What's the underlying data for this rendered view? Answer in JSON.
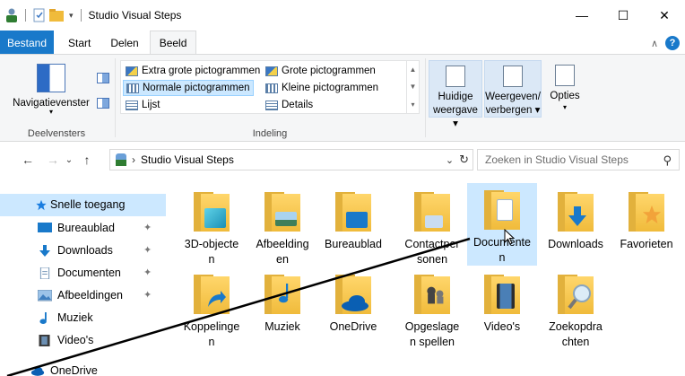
{
  "window": {
    "title": "Studio Visual Steps",
    "controls": {
      "minimize": "—",
      "maximize": "☐",
      "close": "✕"
    }
  },
  "ribbon": {
    "tabs": [
      {
        "label": "Bestand"
      },
      {
        "label": "Start"
      },
      {
        "label": "Delen"
      },
      {
        "label": "Beeld"
      }
    ],
    "panes_group": {
      "label": "Deelvensters",
      "nav_pane_label": "Navigatievenster"
    },
    "layout_group": {
      "label": "Indeling",
      "items": [
        {
          "label": "Extra grote pictogrammen",
          "selected": false
        },
        {
          "label": "Grote pictogrammen",
          "selected": false
        },
        {
          "label": "Normale pictogrammen",
          "selected": true
        },
        {
          "label": "Kleine pictogrammen",
          "selected": false
        },
        {
          "label": "Lijst",
          "selected": false
        },
        {
          "label": "Details",
          "selected": false
        }
      ]
    },
    "buttons": {
      "current_view_line1": "Huidige",
      "current_view_line2": "weergave",
      "show_hide_line1": "Weergeven/",
      "show_hide_line2": "verbergen",
      "options": "Opties"
    }
  },
  "address": {
    "path_label": "Studio Visual Steps",
    "search_placeholder": "Zoeken in Studio Visual Steps"
  },
  "nav_pane": {
    "items": [
      {
        "label": "Snelle toegang",
        "icon": "star-icon",
        "pinned": false,
        "selected": true
      },
      {
        "label": "Bureaublad",
        "icon": "desktop-icon",
        "pinned": true,
        "selected": false
      },
      {
        "label": "Downloads",
        "icon": "download-icon",
        "pinned": true,
        "selected": false
      },
      {
        "label": "Documenten",
        "icon": "document-icon",
        "pinned": true,
        "selected": false
      },
      {
        "label": "Afbeeldingen",
        "icon": "picture-icon",
        "pinned": true,
        "selected": false
      },
      {
        "label": "Muziek",
        "icon": "music-icon",
        "pinned": false,
        "selected": false
      },
      {
        "label": "Video's",
        "icon": "video-icon",
        "pinned": false,
        "selected": false
      },
      {
        "label": "OneDrive",
        "icon": "cloud-icon",
        "pinned": false,
        "selected": false
      }
    ]
  },
  "folders": [
    {
      "line1": "3D-objecte",
      "line2": "n",
      "icon": "3d-objects-icon",
      "selected": false
    },
    {
      "line1": "Afbeelding",
      "line2": "en",
      "icon": "pictures-folder-icon",
      "selected": false
    },
    {
      "line1": "Bureaublad",
      "line2": "",
      "icon": "desktop-folder-icon",
      "selected": false
    },
    {
      "line1": "Contactper",
      "line2": "sonen",
      "icon": "contacts-folder-icon",
      "selected": false
    },
    {
      "line1": "Documente",
      "line2": "n",
      "icon": "documents-folder-icon",
      "selected": true
    },
    {
      "line1": "Downloads",
      "line2": "",
      "icon": "downloads-folder-icon",
      "selected": false
    },
    {
      "line1": "Favorieten",
      "line2": "",
      "icon": "favorites-folder-icon",
      "selected": false
    },
    {
      "line1": "Koppelinge",
      "line2": "n",
      "icon": "links-folder-icon",
      "selected": false
    },
    {
      "line1": "Muziek",
      "line2": "",
      "icon": "music-folder-icon",
      "selected": false
    },
    {
      "line1": "OneDrive",
      "line2": "",
      "icon": "onedrive-folder-icon",
      "selected": false
    },
    {
      "line1": "Opgeslage",
      "line2": "n spellen",
      "icon": "saved-games-folder-icon",
      "selected": false
    },
    {
      "line1": "Video's",
      "line2": "",
      "icon": "videos-folder-icon",
      "selected": false
    },
    {
      "line1": "Zoekopdra",
      "line2": "chten",
      "icon": "searches-folder-icon",
      "selected": false
    }
  ],
  "colors": {
    "accent": "#1979ca",
    "selection": "#cce8ff",
    "folder": "#f0bb3b"
  }
}
